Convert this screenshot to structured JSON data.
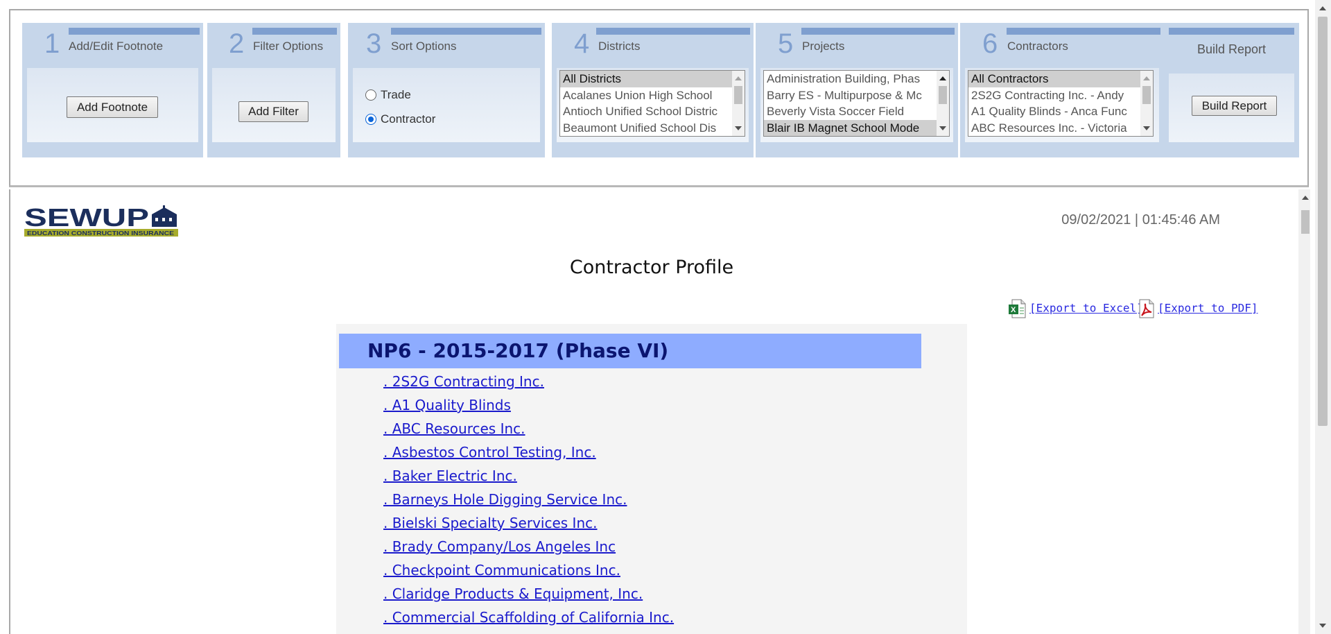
{
  "panels": {
    "footnote": {
      "number": "1",
      "title": "Add/Edit Footnote",
      "button": "Add Footnote"
    },
    "filter": {
      "number": "2",
      "title": "Filter Options",
      "button": "Add Filter"
    },
    "sort": {
      "number": "3",
      "title": "Sort Options",
      "options": [
        "Trade",
        "Contractor"
      ],
      "selected": "Contractor"
    },
    "districts": {
      "number": "4",
      "title": "Districts",
      "items": [
        "All Districts",
        "Acalanes Union High School",
        "Antioch Unified School Distric",
        "Beaumont Unified School Dis"
      ],
      "selected": "All Districts"
    },
    "projects": {
      "number": "5",
      "title": "Projects",
      "items": [
        "Administration Building, Phas",
        "Barry ES - Multipurpose & Mc",
        "Beverly Vista Soccer Field",
        "Blair IB Magnet School Mode"
      ],
      "selected": "Blair IB Magnet School Mode"
    },
    "contractors": {
      "number": "6",
      "title": "Contractors",
      "items": [
        "All Contractors",
        "2S2G Contracting Inc. - Andy",
        "A1 Quality Blinds - Anca Func",
        "ABC Resources Inc. - Victoria"
      ],
      "selected": "All Contractors"
    },
    "build": {
      "title": "Build Report",
      "button": "Build Report"
    }
  },
  "report": {
    "logo_text": "SEWUP",
    "logo_tagline": "EDUCATION CONSTRUCTION INSURANCE",
    "timestamp": "09/02/2021 | 01:45:46 AM",
    "title": "Contractor Profile",
    "export_excel": "[Export to Excel]",
    "export_pdf": "[Export to PDF]",
    "phase_header": "NP6 - 2015-2017 (Phase VI)",
    "contractors": [
      ". 2S2G Contracting Inc.",
      ". A1 Quality Blinds",
      ". ABC Resources Inc.",
      ". Asbestos Control Testing, Inc.",
      ". Baker Electric Inc.",
      ". Barneys Hole Digging Service Inc.",
      ". Bielski Specialty Services Inc.",
      ". Brady Company/Los Angeles Inc",
      ". Checkpoint Communications Inc.",
      ". Claridge Products & Equipment, Inc.",
      ". Commercial Scaffolding of California Inc."
    ]
  },
  "colors": {
    "panel_bg": "#c6d6ea",
    "panel_accent": "#7f9fcf",
    "phase_header_bg": "#8eacff",
    "link": "#1a1acc"
  }
}
